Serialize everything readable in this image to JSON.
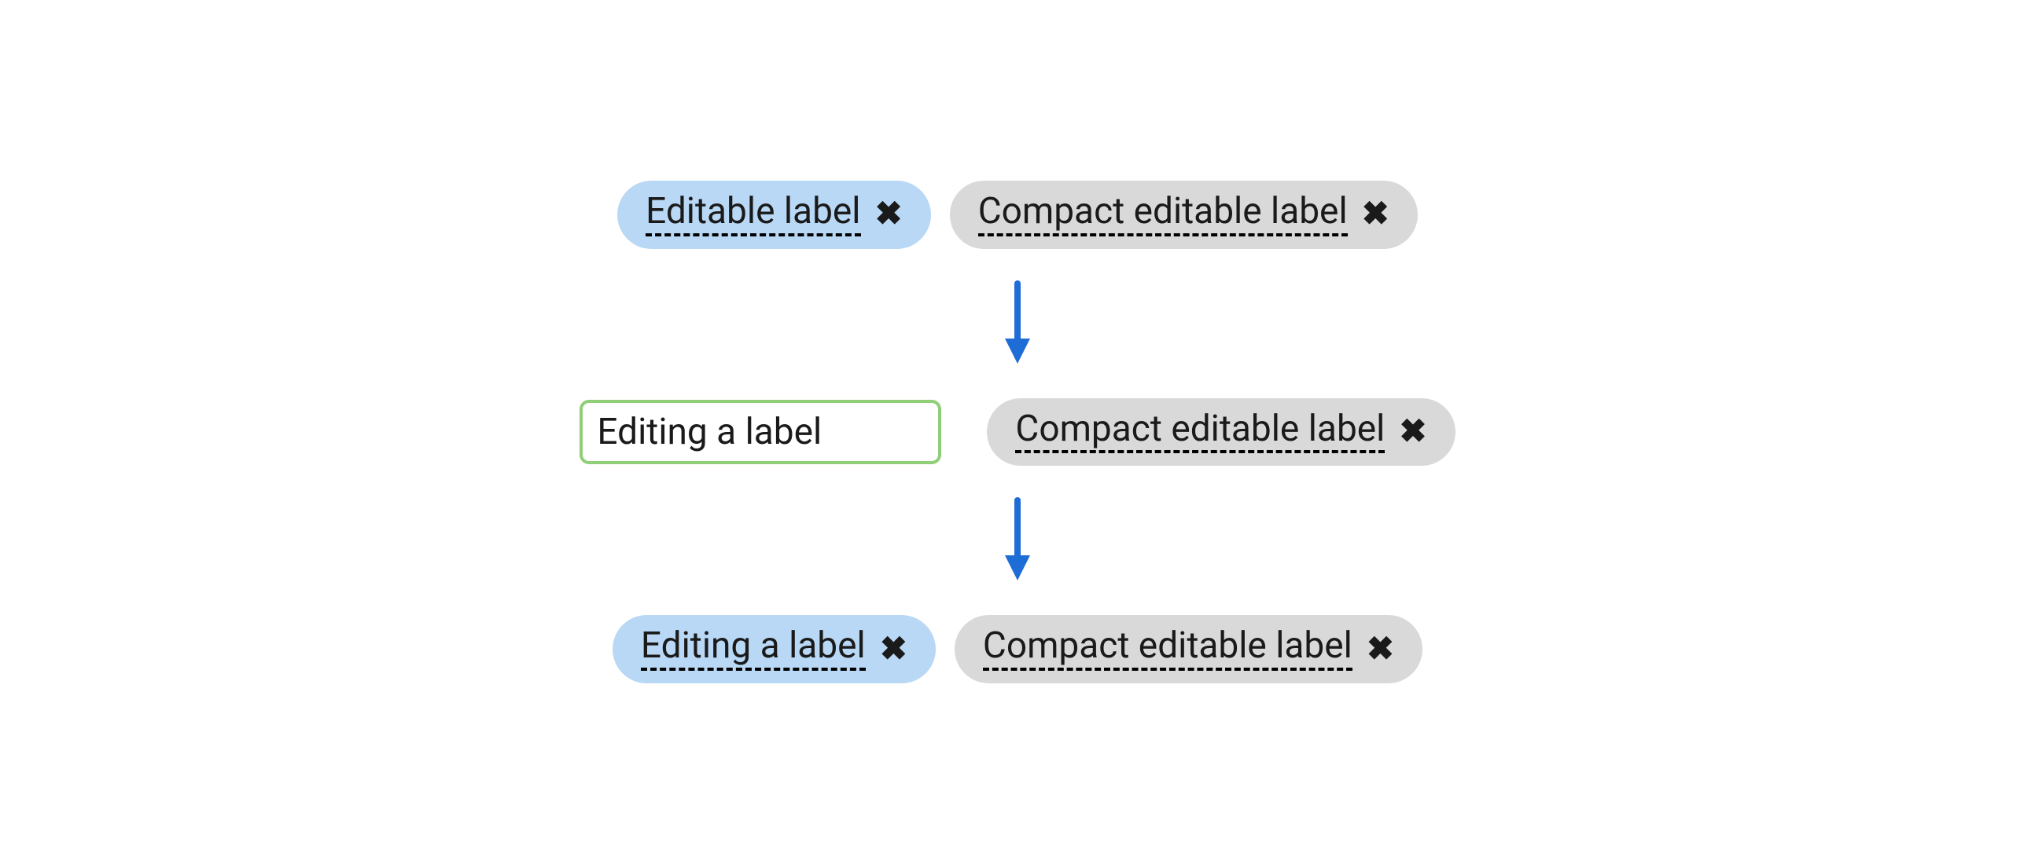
{
  "row1": {
    "left_label": "Editable label",
    "right_label": "Compact editable label"
  },
  "row2": {
    "input_value": "Editing a label",
    "right_label": "Compact editable label"
  },
  "row3": {
    "left_label": "Editing a label",
    "right_label": "Compact editable label"
  },
  "icons": {
    "close_glyph": "✖",
    "arrow_color": "#1e6cd6"
  }
}
